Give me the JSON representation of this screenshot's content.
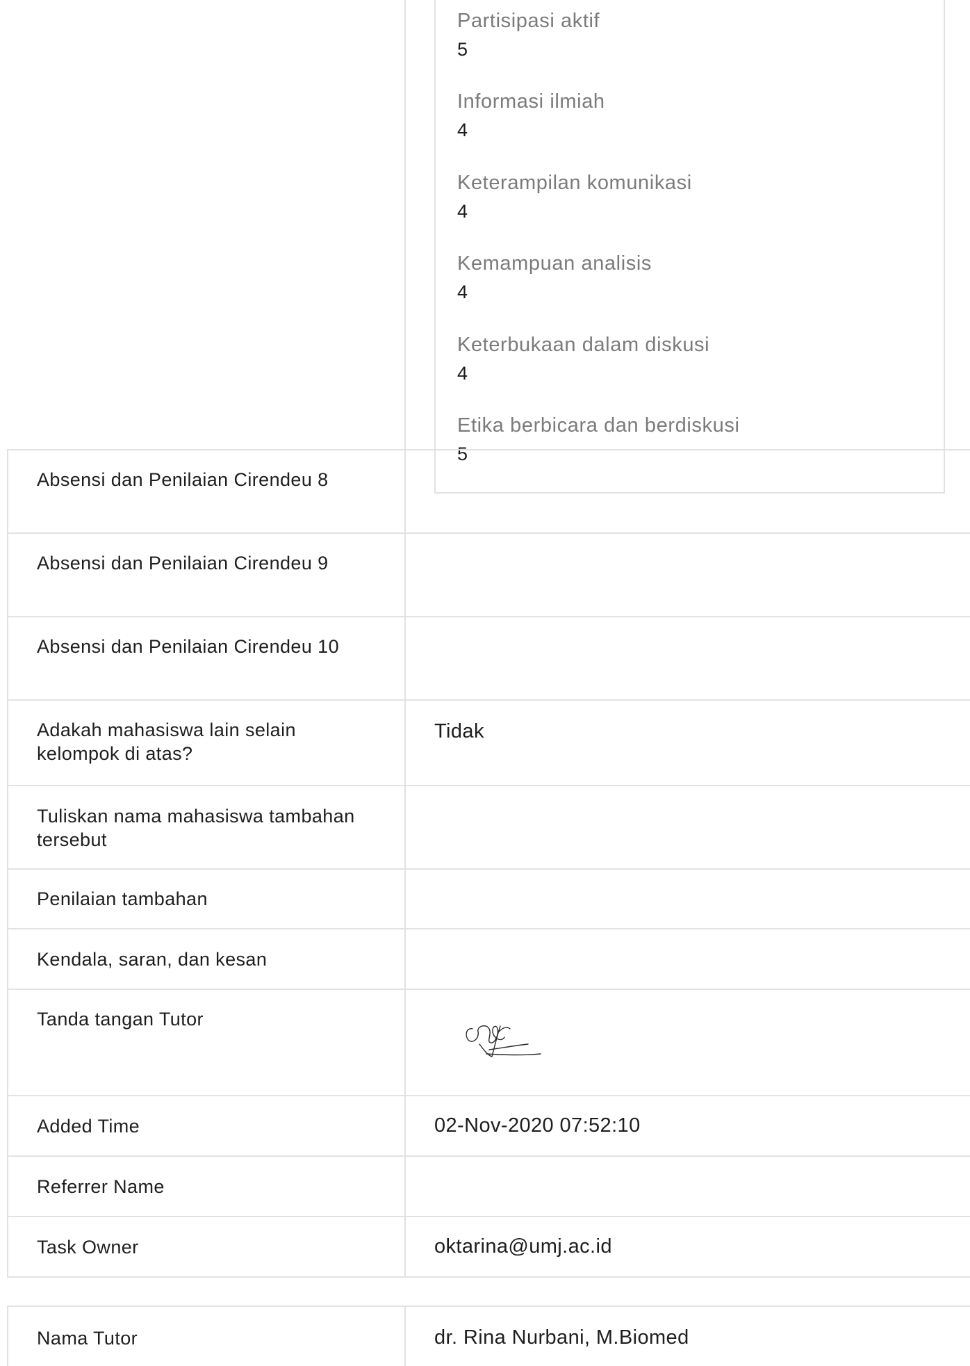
{
  "ratings": [
    {
      "label": "Partisipasi aktif",
      "value": "5"
    },
    {
      "label": "Informasi ilmiah",
      "value": "4"
    },
    {
      "label": "Keterampilan komunikasi",
      "value": "4"
    },
    {
      "label": "Kemampuan analisis",
      "value": "4"
    },
    {
      "label": "Keterbukaan dalam diskusi",
      "value": "4"
    },
    {
      "label": "Etika berbicara dan berdiskusi",
      "value": "5"
    }
  ],
  "rows": [
    {
      "label": "Absensi dan Penilaian Cirendeu 8",
      "value": ""
    },
    {
      "label": "Absensi dan Penilaian Cirendeu 9",
      "value": ""
    },
    {
      "label": "Absensi dan Penilaian Cirendeu 10",
      "value": ""
    },
    {
      "label": "Adakah mahasiswa lain selain kelompok di atas?",
      "value": "Tidak"
    },
    {
      "label": "Tuliskan nama mahasiswa tambahan tersebut",
      "value": ""
    },
    {
      "label": "Penilaian tambahan",
      "value": ""
    },
    {
      "label": "Kendala, saran, dan kesan",
      "value": ""
    },
    {
      "label": "Tanda tangan Tutor",
      "value": ""
    },
    {
      "label": "Added Time",
      "value": "02-Nov-2020 07:52:10"
    },
    {
      "label": "Referrer Name",
      "value": ""
    },
    {
      "label": "Task Owner",
      "value": "oktarina@umj.ac.id"
    }
  ],
  "tutor": {
    "label": "Nama Tutor",
    "value": "dr. Rina Nurbani, M.Biomed"
  },
  "icons": {
    "signature": "tutor-signature-icon"
  }
}
